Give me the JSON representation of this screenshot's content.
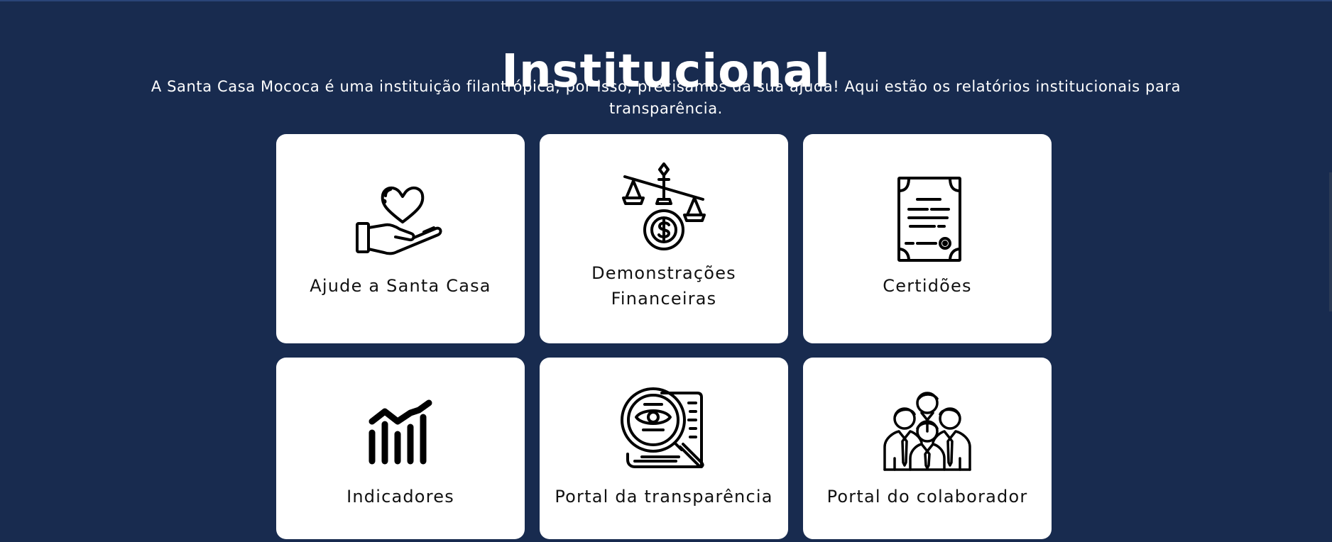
{
  "header": {
    "title": "Institucional",
    "subtitle": "A Santa Casa Mococa é uma instituição filantrópica, por isso, precisamos da sua ajuda! Aqui estão os relatórios institucionais para transparência."
  },
  "cards": [
    {
      "label": "Ajude a Santa Casa",
      "icon": "heart-in-hand-icon"
    },
    {
      "label": "Demonstrações Financeiras",
      "icon": "balance-scale-coin-icon"
    },
    {
      "label": "Certidões",
      "icon": "certificate-document-icon"
    },
    {
      "label": "Indicadores",
      "icon": "bar-chart-trend-icon"
    },
    {
      "label": "Portal da transparência",
      "icon": "magnifier-eye-document-icon"
    },
    {
      "label": "Portal do colaborador",
      "icon": "team-people-icon"
    }
  ],
  "colors": {
    "background": "#182b4f",
    "card": "#ffffff",
    "text": "#ffffff",
    "icon": "#000000"
  }
}
